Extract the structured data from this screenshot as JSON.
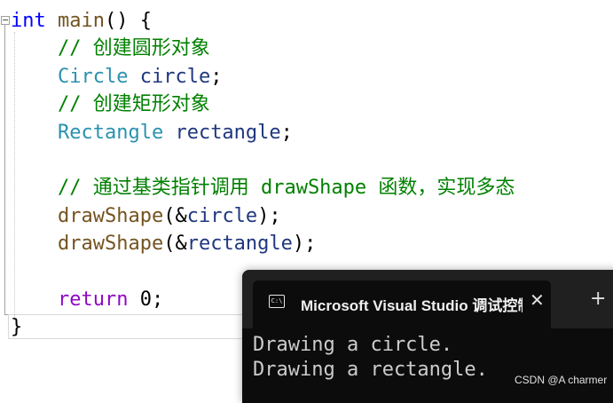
{
  "editor": {
    "code_lines": [
      [
        {
          "t": "int",
          "c": "kw"
        },
        {
          "t": " ",
          "c": "plain"
        },
        {
          "t": "main",
          "c": "fn"
        },
        {
          "t": "() {",
          "c": "plain"
        }
      ],
      [
        {
          "t": "    // 创建圆形对象",
          "c": "cm"
        }
      ],
      [
        {
          "t": "    ",
          "c": "plain"
        },
        {
          "t": "Circle",
          "c": "ty"
        },
        {
          "t": " ",
          "c": "plain"
        },
        {
          "t": "circle",
          "c": "var"
        },
        {
          "t": ";",
          "c": "plain"
        }
      ],
      [
        {
          "t": "    // 创建矩形对象",
          "c": "cm"
        }
      ],
      [
        {
          "t": "    ",
          "c": "plain"
        },
        {
          "t": "Rectangle",
          "c": "ty"
        },
        {
          "t": " ",
          "c": "plain"
        },
        {
          "t": "rectangle",
          "c": "var"
        },
        {
          "t": ";",
          "c": "plain"
        }
      ],
      [],
      [
        {
          "t": "    // 通过基类指针调用 drawShape 函数，实现多态",
          "c": "cm"
        }
      ],
      [
        {
          "t": "    ",
          "c": "plain"
        },
        {
          "t": "drawShape",
          "c": "fn"
        },
        {
          "t": "(&",
          "c": "plain"
        },
        {
          "t": "circle",
          "c": "var"
        },
        {
          "t": ");",
          "c": "plain"
        }
      ],
      [
        {
          "t": "    ",
          "c": "plain"
        },
        {
          "t": "drawShape",
          "c": "fn"
        },
        {
          "t": "(&",
          "c": "plain"
        },
        {
          "t": "rectangle",
          "c": "var"
        },
        {
          "t": ");",
          "c": "plain"
        }
      ],
      [],
      [
        {
          "t": "    ",
          "c": "plain"
        },
        {
          "t": "return",
          "c": "kw2"
        },
        {
          "t": " 0;",
          "c": "plain"
        }
      ],
      [
        {
          "t": "}",
          "c": "plain"
        }
      ]
    ]
  },
  "console": {
    "tab_title": "Microsoft Visual Studio 调试控制台",
    "tab_icon_text": "C:\\",
    "close_glyph": "✕",
    "new_tab_glyph": "+",
    "output": [
      "Drawing a circle.",
      "Drawing a rectangle."
    ]
  },
  "watermark": "CSDN @A charmer"
}
